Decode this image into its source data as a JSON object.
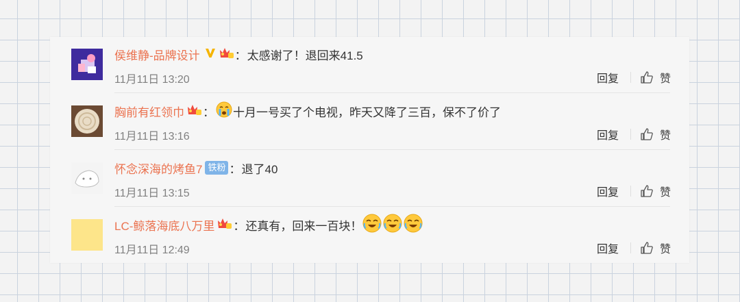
{
  "comments": [
    {
      "user": "侯维静-品牌设计",
      "colon": "：",
      "text": "太感谢了！退回来41.5",
      "time": "11月11日 13:20"
    },
    {
      "user": "胸前有红领巾",
      "colon": "：",
      "text": "十月一号买了个电视，昨天又降了三百，保不了价了",
      "time": "11月11日 13:16"
    },
    {
      "user": "怀念深海的烤鱼7",
      "badge": "铁粉",
      "colon": "：",
      "text": "退了40",
      "time": "11月11日 13:15"
    },
    {
      "user": "LC-鲸落海底八万里",
      "colon": "：",
      "text": "还真有，回来一百块！",
      "time": "11月11日 12:49"
    }
  ],
  "actions": {
    "reply": "回复",
    "like": "赞"
  },
  "colors": {
    "username": "#eb7350",
    "text": "#333333",
    "time": "#808080",
    "fan_badge": "#7fb4e8"
  },
  "icons": [
    "verified-v-icon",
    "member-crown-icon",
    "crying-emoji-icon",
    "laughing-emoji-icon",
    "thumbs-up-icon"
  ]
}
